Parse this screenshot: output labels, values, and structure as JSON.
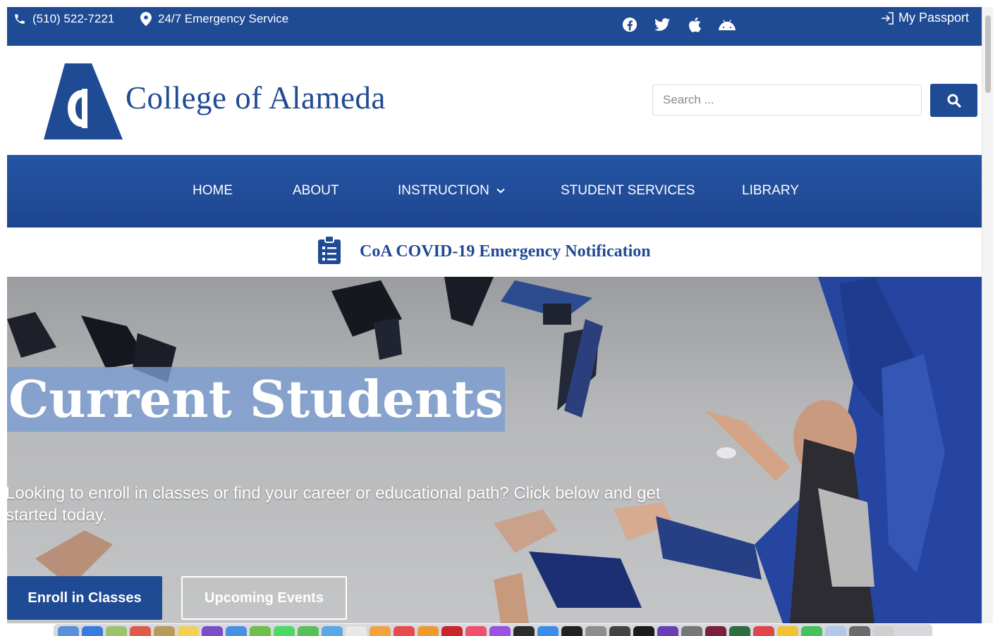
{
  "topbar": {
    "phone": "(510) 522-7221",
    "emergency": "24/7 Emergency Service",
    "social_icons": [
      "facebook-icon",
      "twitter-icon",
      "apple-icon",
      "android-icon"
    ],
    "passport_label": "My Passport"
  },
  "header": {
    "college_name": "College of Alameda",
    "search_placeholder": "Search ..."
  },
  "nav": {
    "items": [
      {
        "label": "HOME"
      },
      {
        "label": "ABOUT"
      },
      {
        "label": "INSTRUCTION"
      },
      {
        "label": "STUDENT SERVICES"
      },
      {
        "label": "LIBRARY"
      }
    ]
  },
  "notice": {
    "text": "CoA COVID-19 Emergency Notification"
  },
  "hero": {
    "title": "Current Students",
    "subtitle": "Looking to enroll in classes or find your career or educational path? Click below and get started today.",
    "enroll_label": "Enroll in Classes",
    "events_label": "Upcoming Events"
  },
  "colors": {
    "brand_blue": "#1f4a94",
    "title_highlight": "#7a9cd2"
  }
}
